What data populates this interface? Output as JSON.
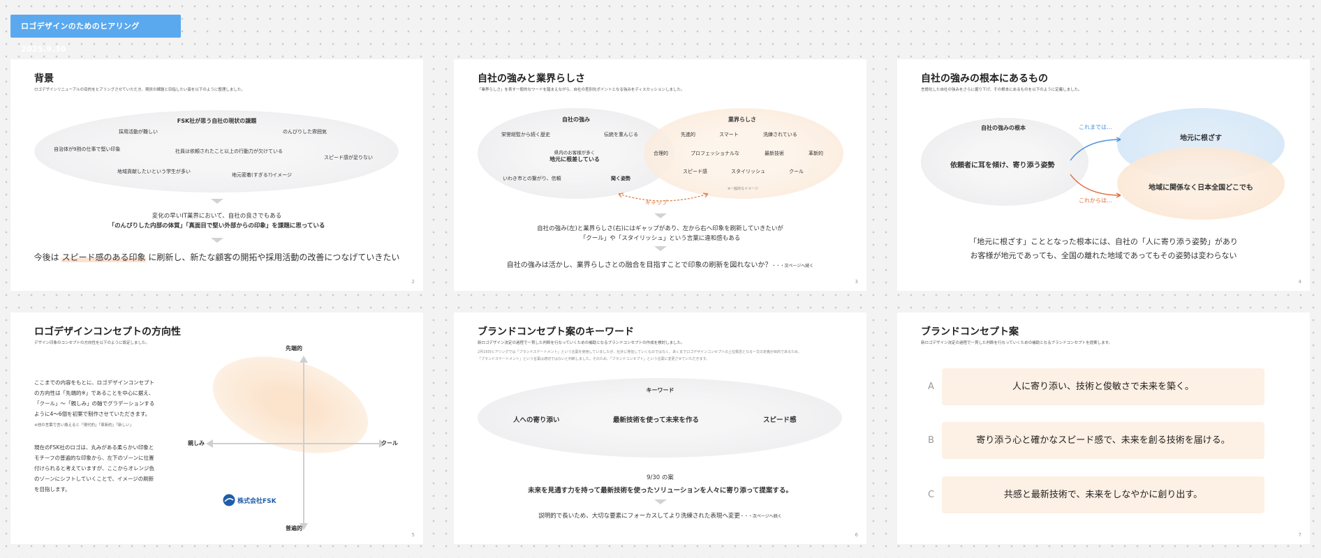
{
  "header": {
    "badge": "ロゴデザインのためのヒアリング　2025.9.30"
  },
  "s2": {
    "title": "背景",
    "subtitle": "ロゴデザインリニューアルの目的をヒアリングさせていただき、現状の課題と目指したい姿を以下のように整理しました。",
    "oval_title": "FSK社が思う自社の現状の課題",
    "items": [
      "採用活動が難しい",
      "のんびりした雰囲気",
      "自治体が9割の仕事で堅い印象",
      "社員は依頼されたこと以上の行動力が欠けている",
      "スピード感が足りない",
      "地域貢献したいという学生が多い",
      "地元密着(すぎる?)イメージ"
    ],
    "line1": "変化の早いIT業界において、自社の良さでもある",
    "line2": "「のんびりした内部の体質」「真面目で堅い外部からの印象」を課題に思っている",
    "conc_pre": "今後は ",
    "conc_mark": "スピード感のある印象",
    "conc_post": " に刷新し、新たな顧客の開拓や採用活動の改善につなげていきたい",
    "page": "2"
  },
  "s3": {
    "title": "自社の強みと業界らしさ",
    "subtitle": "「業界らしさ」を表す一般的なワードを踏まえながら、自社の差別化ポイントとなる強みをディスカッションしました。",
    "left_title": "自社の強み",
    "right_title": "業界らしさ",
    "left_items": [
      "栄誉総監から続く歴史",
      "伝統を重んじる",
      "県内のお客様が多く",
      "地元に根差している",
      "いわき市との繋がり、信頼",
      "聞く姿勢"
    ],
    "right_items": [
      "先進的",
      "スマート",
      "洗練されている",
      "合理的",
      "プロフェッショナルな",
      "最新技術",
      "革新的",
      "スピード感",
      "スタイリッシュ",
      "クール",
      "※一般的なイメージ"
    ],
    "gap": "ギャップ",
    "line1": "自社の強み(左)と業界らしさ(右)にはギャップがあり、左から右へ印象を刷新していきたいが",
    "line2": "「クール」や「スタイリッシュ」という言葉に違和感もある",
    "conc": "自社の強みは活かし、業界らしさとの融合を目指すことで印象の刷新を図れないか？",
    "conc_small": "・・・次ページへ続く",
    "page": "3"
  },
  "s4": {
    "title": "自社の強みの根本にあるもの",
    "subtitle": "言語化した自社の強みをさらに掘り下げ、その根本にあるものを以下のように定義しました。",
    "left_title": "自社の強みの根本",
    "left_main": "依頼者に耳を傾け、寄り添う姿勢",
    "upper": "これまでは…",
    "lower": "これからは…",
    "right_top": "地元に根ざす",
    "right_bottom": "地域に関係なく日本全国どこでも",
    "line1": "「地元に根ざす」こととなった根本には、自社の「人に寄り添う姿勢」があり",
    "line2": "お客様が地元であっても、全国の離れた地域であってもその姿勢は変わらない",
    "page": "4"
  },
  "s5": {
    "title": "ロゴデザインコンセプトの方向性",
    "subtitle": "デザイン印象のコンセプトの方向性を以下のように設定しました。",
    "p1": [
      "ここまでの内容をもとに、ロゴデザインコンセプト",
      "の方向性は「先端的※」であることを中心に据え、",
      "「クール」〜「親しみ」の軸でグラデーションする",
      "ように4〜6個を初案で制作させていただきます。"
    ],
    "note": "※他の言葉で言い換えると「現代的」「革新的」「新しい」",
    "p2": [
      "現在のFSK社のロゴは、丸みがある柔らかい印象と",
      "モチーフの普遍的な印象から、左下のゾーンに位置",
      "付けられると考えていますが、ここからオレンジ色",
      "のゾーンにシフトしていくことで、イメージの刷新",
      "を目指します。"
    ],
    "axis_top": "先端的",
    "axis_bottom": "普遍的",
    "axis_left": "親しみ",
    "axis_right": "クール",
    "logo_text": "株式会社FSK",
    "page": "5"
  },
  "s6": {
    "title": "ブランドコンセプト案のキーワード",
    "subtitle": "新ロゴデザイン決定の過程で一貫した判断を行なっていくための補助となるブランドコンセプトの作成を検討しました。",
    "note1": "2月16日ヒアリングでは「ブランドステートメント」という言葉を使用していましたが、社外に発信していくものではなく、あくまでロゴデザインコンセプトの上位概念となる一文の定義が目的であるため、",
    "note2": "「ブランドステートメント」という言葉は適切ではないと判断しました。そのため、「ブランドコンセプト」という言葉に変更させていただきます。",
    "kw_title": "キーワード",
    "kws": [
      "人への寄り添い",
      "最新技術を使って未来を作る",
      "スピード感"
    ],
    "plan_label": "9/30 の案",
    "plan": "未来を見通す力を持って最新技術を使ったソリューションを人々に寄り添って提案する。",
    "conc": "説明的で長いため、大切な要素にフォーカスしてより洗練された表現へ変更",
    "conc_small": "・・・次ページへ続く",
    "page": "6"
  },
  "s7": {
    "title": "ブランドコンセプト案",
    "subtitle": "新ロゴデザイン決定の過程で一貫した判断を行なっていくための補助となるブランドコンセプトを提案します。",
    "options": [
      {
        "label": "A",
        "text": "人に寄り添い、技術と俊敏さで未来を築く。"
      },
      {
        "label": "B",
        "text": "寄り添う心と確かなスピード感で、未来を創る技術を届ける。"
      },
      {
        "label": "C",
        "text": "共感と最新技術で、未来をしなやかに創り出す。"
      }
    ],
    "page": "7"
  }
}
